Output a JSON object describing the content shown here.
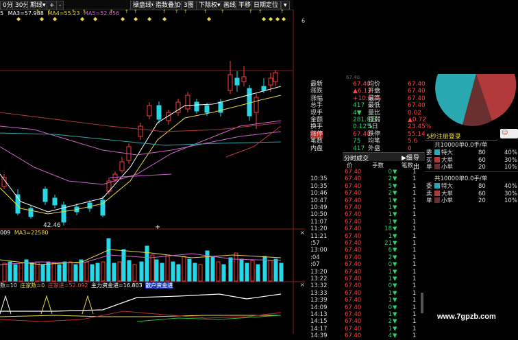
{
  "toolbar": {
    "items": [
      "0分",
      "30分",
      "期线",
      "▾",
      "+",
      "-"
    ],
    "right_items": [
      "操盘线▾",
      "指数叠加▾",
      "3图",
      "下除权▾",
      "画线",
      "平移",
      "日期定位",
      "▾"
    ]
  },
  "ma_legend": {
    "ma3": "MA3=57.988",
    "ma4": "MA4=55.23",
    "ma5": "MA5=52.656",
    "prefix": "5"
  },
  "price_marks": {
    "low_label": "42.46"
  },
  "vol_legend": {
    "vol": "009",
    "ma3": "MA3=22580"
  },
  "ind_legend": {
    "a": "数=10",
    "b": "庄家数=0",
    "c": "庄家进=52.092",
    "d": "主力资金进=16.803",
    "e": "散户资金进"
  },
  "info": {
    "header": "67.40",
    "rows": [
      {
        "l": "最新",
        "v": "67.40",
        "l2": "均价",
        "v2": "67.40"
      },
      {
        "l": "涨跌",
        "v": "▲6.13",
        "l2": "开盘",
        "v2": "67.40"
      },
      {
        "l": "涨幅",
        "v": "+10.00%",
        "l2": "最高",
        "v2": "67.40"
      },
      {
        "l": "总手",
        "v": "417",
        "l2": "最低",
        "v2": "67.40"
      },
      {
        "l": "现手",
        "v": "4▼",
        "l2": "量比",
        "v2": "0.02"
      },
      {
        "l": "金额",
        "v": "281.0万",
        "l2": "强弱",
        "v2": "▲0.72"
      },
      {
        "l": "换手",
        "v": "0.12%",
        "l2": "5日",
        "v2": "23.45%"
      },
      {
        "l": "涨停",
        "v": "67.40",
        "l2": "跌停",
        "v2": "55.14"
      },
      {
        "l": "笔数",
        "v": "75",
        "l2": "均笔",
        "v2": "5.6"
      },
      {
        "l": "内盘",
        "v": "417",
        "l2": "外盘",
        "v2": "0"
      }
    ]
  },
  "tick": {
    "title": "分时成交",
    "btn1": "细",
    "btn2": "导出",
    "col_time": "时间",
    "col_price": "价",
    "col_vol": "手数",
    "col_cnt": "笔数",
    "rows": [
      {
        "t": "",
        "p": "67.40",
        "v": "0",
        "d": "▼",
        "c": "1"
      },
      {
        "t": "10:35",
        "p": "67.40",
        "v": "2",
        "d": "▼",
        "c": "1"
      },
      {
        "t": "10:35",
        "p": "67.40",
        "v": "5",
        "d": "▼",
        "c": "1"
      },
      {
        "t": "10:46",
        "p": "67.40",
        "v": "2",
        "d": "▼",
        "c": "1"
      },
      {
        "t": "10:47",
        "p": "67.40",
        "v": "1",
        "d": "▼",
        "c": "1"
      },
      {
        "t": "10:49",
        "p": "67.40",
        "v": "1",
        "d": "▼",
        "c": "1"
      },
      {
        "t": "10:50",
        "p": "67.40",
        "v": "1",
        "d": "▼",
        "c": "1"
      },
      {
        "t": "11:07",
        "p": "67.40",
        "v": "1",
        "d": "▼",
        "c": "1"
      },
      {
        "t": "11:20",
        "p": "67.40",
        "v": "18",
        "d": "▼",
        "c": "1"
      },
      {
        "t": "11:21",
        "p": "67.40",
        "v": "1",
        "d": "▼",
        "c": "1"
      },
      {
        "t": ":57",
        "p": "67.40",
        "v": "21",
        "d": "▼",
        "c": "1"
      },
      {
        "t": "13:00",
        "p": "67.40",
        "v": "6",
        "d": "▼",
        "c": "1"
      },
      {
        "t": ":04",
        "p": "67.40",
        "v": "2",
        "d": "▼",
        "c": "1"
      },
      {
        "t": ":07",
        "p": "67.40",
        "v": "0",
        "d": "▼",
        "c": "1"
      },
      {
        "t": "13:20",
        "p": "67.40",
        "v": "1",
        "d": "▼",
        "c": "1"
      },
      {
        "t": "13:22",
        "p": "67.40",
        "v": "1",
        "d": "▼",
        "c": "1"
      },
      {
        "t": "13:32",
        "p": "67.40",
        "v": "0",
        "d": "▼",
        "c": "1"
      },
      {
        "t": "13:33",
        "p": "67.40",
        "v": "1",
        "d": "▼",
        "c": "1"
      },
      {
        "t": "13:39",
        "p": "67.40",
        "v": "1",
        "d": "▼",
        "c": "1"
      },
      {
        "t": "14:09",
        "p": "67.40",
        "v": "0",
        "d": "▼",
        "c": "1"
      },
      {
        "t": "14:13",
        "p": "67.40",
        "v": "1",
        "d": "▼",
        "c": "1"
      },
      {
        "t": "14:15",
        "p": "67.40",
        "v": "2",
        "d": "▼",
        "c": "1"
      },
      {
        "t": "14:17",
        "p": "67.40",
        "v": "1",
        "d": "▼",
        "c": "1"
      },
      {
        "t": "14:39",
        "p": "67.40",
        "v": "4",
        "d": "▼",
        "c": "1"
      }
    ]
  },
  "flow": {
    "title": "5秒注册登录",
    "sec1_title": "共10000单0.0手/单",
    "sec1": [
      {
        "side": "委",
        "name": "特大",
        "n": "80",
        "pct": "40%"
      },
      {
        "side": "买",
        "name": "大单",
        "n": "60",
        "pct": "30%"
      },
      {
        "side": "单",
        "name": "小单",
        "n": "20",
        "pct": "10%"
      }
    ],
    "sec2_title": "共10000单0.0手/单",
    "sec2": [
      {
        "side": "委",
        "name": "特大",
        "n": "80",
        "pct": "40%"
      },
      {
        "side": "卖",
        "name": "大单",
        "n": "60",
        "pct": "30%"
      },
      {
        "side": "单",
        "name": "小单",
        "n": "20",
        "pct": "10%"
      }
    ],
    "colors": {
      "big": "#2aa9b3",
      "mid": "#b23a3a",
      "small": "#6a2f2f"
    }
  },
  "watermark": "www.7gpzb.com"
}
